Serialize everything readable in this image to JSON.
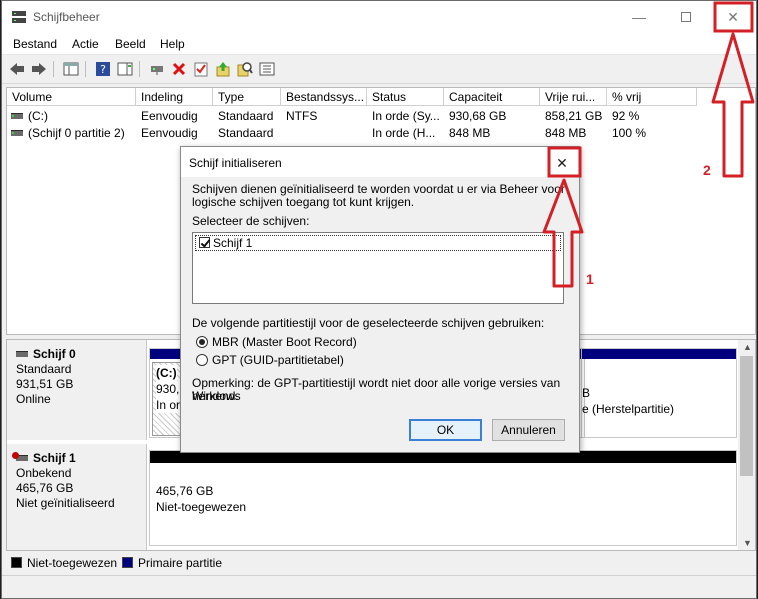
{
  "window": {
    "title": "Schijfbeheer"
  },
  "menu": [
    "Bestand",
    "Actie",
    "Beeld",
    "Help"
  ],
  "volume_table": {
    "columns": [
      "Volume",
      "Indeling",
      "Type",
      "Bestandssys...",
      "Status",
      "Capaciteit",
      "Vrije rui...",
      "% vrij"
    ],
    "rows": [
      [
        "(C:)",
        "Eenvoudig",
        "Standaard",
        "NTFS",
        "In orde (Sy...",
        "930,68 GB",
        "858,21 GB",
        "92 %"
      ],
      [
        "(Schijf 0 partitie 2)",
        "Eenvoudig",
        "Standaard",
        "",
        "In orde (H...",
        "848 MB",
        "848 MB",
        "100 %"
      ]
    ]
  },
  "disks": [
    {
      "name": "Schijf 0",
      "type": "Standaard",
      "size": "931,51 GB",
      "state": "Online",
      "partition_main": {
        "label": "(C:)",
        "size": "930,6",
        "status": "In ord"
      },
      "partition_right": {
        "size": "B",
        "status": "e (Herstelpartitie)"
      }
    },
    {
      "name": "Schijf 1",
      "type": "Onbekend",
      "size": "465,76 GB",
      "state": "Niet geïnitialiseerd",
      "partition_main": {
        "size": "465,76 GB",
        "status": "Niet-toegewezen"
      }
    }
  ],
  "legend": [
    {
      "label": "Niet-toegewezen",
      "color": "#000000"
    },
    {
      "label": "Primaire partitie",
      "color": "#00007f"
    }
  ],
  "dialog": {
    "title": "Schijf initialiseren",
    "intro_line1": "Schijven dienen geïnitialiseerd te worden voordat u er via Beheer voor",
    "intro_line2": "logische schijven toegang tot kunt krijgen.",
    "select_label": "Selecteer de schijven:",
    "disk_item": "Schijf 1",
    "style_label": "De volgende partitiestijl voor de geselecteerde schijven gebruiken:",
    "option_mbr": "MBR (Master Boot Record)",
    "option_gpt": "GPT (GUID-partitietabel)",
    "note_line1": "Opmerking: de GPT-partitiestijl wordt niet door alle vorige versies van Windows",
    "note_line2": "herkend.",
    "ok": "OK",
    "cancel": "Annuleren"
  },
  "annotations": {
    "number1": "1",
    "number2": "2",
    "color": "#d32027"
  },
  "icons": [
    "back-arrow-icon",
    "forward-arrow-icon",
    "console-tree-icon",
    "help-icon",
    "action-pane-icon",
    "connect-icon",
    "delete-icon",
    "properties-icon",
    "import-icon",
    "search-icon",
    "list-icon"
  ]
}
